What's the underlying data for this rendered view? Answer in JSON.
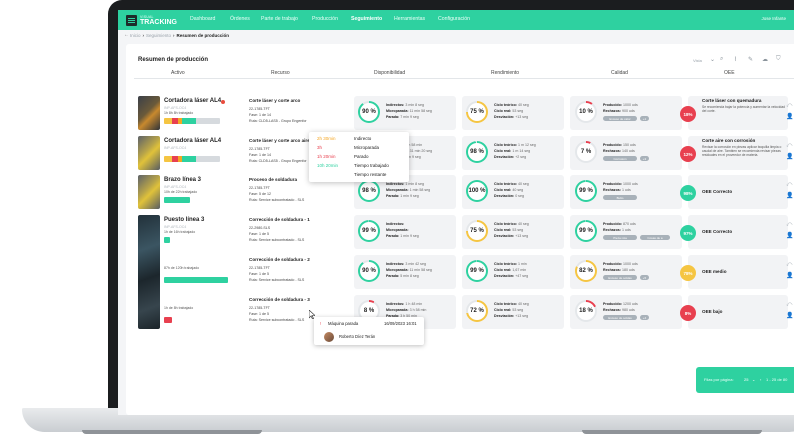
{
  "nav": {
    "logo_small": "VISUAL",
    "logo_big": "TRACKING",
    "items": [
      "Dashboard",
      "Órdenes",
      "Parte de trabajo",
      "Producción",
      "Seguimiento",
      "Herramientas",
      "Configuración"
    ],
    "active": "Seguimiento",
    "user": "Jose Infante"
  },
  "breadcrumb": {
    "items": [
      "Inicio",
      "Seguimiento"
    ],
    "current": "Resumen de producción"
  },
  "card": {
    "title": "Resumen de producción",
    "view_label": "Vista",
    "columns": [
      "Activo",
      "Recurso",
      "Disponibilidad",
      "Rendimiento",
      "Calidad",
      "OEE"
    ]
  },
  "rows": [
    {
      "asset": {
        "name": "Cortadora láser AL4",
        "code": "INP-AFS-OC4",
        "status": "1h 8h 8h trabajado"
      },
      "job": {
        "title": "Corte láser y corte arco",
        "ref": "22-1785-TFT",
        "phase": "Fase: 1 de 14",
        "route": "Ruta: CLD5-LAS5 - Grupo Engenfor"
      },
      "availability": {
        "pct": "90 %",
        "value": 90,
        "l1": "Indirectos:",
        "v1": "3 min 8 seg",
        "l2": "Microparada:",
        "v2": "11 min 58 seg",
        "l3": "Parada:",
        "v3": "7 min 9 seg"
      },
      "performance": {
        "pct": "75 %",
        "value": 75,
        "l1": "Ciclo teórico:",
        "v1": "40 seg",
        "l2": "Ciclo real:",
        "v2": "53 seg",
        "l3": "Desviación:",
        "v3": "+13 seg"
      },
      "quality": {
        "pct": "10 %",
        "value": 10,
        "l1": "Producido:",
        "v1": "1000 uds",
        "l2": "Rechazos:",
        "v2": "900 uds",
        "pill1": "Exceso de calor",
        "pill2": "+1"
      },
      "oee": {
        "value": "18%",
        "color": "#e8404f",
        "title": "Corte láser con quemadura",
        "desc": "Se recomienda bajar la potencia y aumentar la velocidad del corte."
      }
    },
    {
      "asset": {
        "name": "Cortadora láser AL4",
        "code": "INP-AFS-OC4",
        "status": ""
      },
      "job": {
        "title": "Corte láser y corte arco aire",
        "ref": "22-1785-TFT",
        "phase": "Fase: 1 de 14",
        "route": "Ruta: CLD5-LAS5 - Grupo Engenfor"
      },
      "availability": {
        "pct": "42 %",
        "value": 42,
        "l1": "Indirectos:",
        "v1": "1 h 58 min",
        "l2": "Microparada:",
        "v2": "31 min 20 seg",
        "l3": "Parada:",
        "v3": "50 min 9 seg"
      },
      "performance": {
        "pct": "98 %",
        "value": 98,
        "l1": "Ciclo teórico:",
        "v1": "1 m 12 seg",
        "l2": "Ciclo real:",
        "v2": "1 m 14 seg",
        "l3": "Desviación:",
        "v3": "+2 seg"
      },
      "quality": {
        "pct": "7 %",
        "value": 7,
        "l1": "Producido:",
        "v1": "150 uds",
        "l2": "Rechazos:",
        "v2": "140 uds",
        "pill1": "Corrosión",
        "pill2": "+3"
      },
      "oee": {
        "value": "12%",
        "color": "#e8404f",
        "title": "Corte aire con corrosión",
        "desc": "Revisar la corrosión en piezas aplicar boquilla limpia o caudal de aire. Tambien se recomienda revisar piezas residuales en el proveedor de materia."
      }
    },
    {
      "asset": {
        "name": "Brazo línea 3",
        "code": "INP-AFS-OC4",
        "status": "10h de 22h trabajado"
      },
      "job": {
        "title": "Proceso de soldadura",
        "ref": "22-1785-TFT",
        "phase": "Fase: 5 de 12",
        "route": "Ruta: Service subcontratado - SLS"
      },
      "availability": {
        "pct": "98 %",
        "value": 98,
        "l1": "Indirectos:",
        "v1": "1 min 8 seg",
        "l2": "Microparada:",
        "v2": "1 min 58 seg",
        "l3": "Parada:",
        "v3": "1 min 9 seg"
      },
      "performance": {
        "pct": "100 %",
        "value": 100,
        "l1": "Ciclo teórico:",
        "v1": "40 seg",
        "l2": "Ciclo real:",
        "v2": "40 seg",
        "l3": "Desviación:",
        "v3": "0 seg"
      },
      "quality": {
        "pct": "99 %",
        "value": 99,
        "l1": "Producido:",
        "v1": "1000 uds",
        "l2": "Rechazos:",
        "v2": "1 uds",
        "pill1": "Bulto",
        "pill2": ""
      },
      "oee": {
        "value": "98%",
        "color": "#2ed1a0",
        "title": "OEE Correcto",
        "desc": ""
      }
    },
    {
      "asset": {
        "name": "Puesto línea 3",
        "code": "INP-AFS-OC4",
        "status": "1h de 16h trabajado"
      },
      "job": {
        "title": "Corrección de soldadura - 1",
        "ref": "22-2980-SLS",
        "phase": "Fase: 1 de 5",
        "route": "Ruta: Service subcontratado - SLS"
      },
      "availability": {
        "pct": "99 %",
        "value": 99,
        "l1": "Indirectos:",
        "v1": "",
        "l2": "Microparada:",
        "v2": "",
        "l3": "Parada:",
        "v3": "1 min 9 seg"
      },
      "performance": {
        "pct": "75 %",
        "value": 75,
        "l1": "Ciclo teórico:",
        "v1": "40 seg",
        "l2": "Ciclo real:",
        "v2": "53 seg",
        "l3": "Desviación:",
        "v3": "+13 seg"
      },
      "quality": {
        "pct": "99 %",
        "value": 99,
        "l1": "Producido:",
        "v1": "870 uds",
        "l2": "Rechazos:",
        "v2": "1 uds",
        "pill1": "Pieza rota",
        "pill2": "Cosas de a"
      },
      "oee": {
        "value": "97%",
        "color": "#2ed1a0",
        "title": "OEE Correcto",
        "desc": ""
      }
    },
    {
      "asset": {
        "name": "",
        "code": "",
        "status": "87h de 120h trabajado"
      },
      "job": {
        "title": "Corrección de soldadura - 2",
        "ref": "22-1785-TFT",
        "phase": "Fase: 1 de 5",
        "route": "Ruta: Service subcontratado - SLS"
      },
      "availability": {
        "pct": "90 %",
        "value": 90,
        "l1": "Indirectos:",
        "v1": "3 min 42 seg",
        "l2": "Microparada:",
        "v2": "11 min 58 seg",
        "l3": "Parada:",
        "v3": "5 min 8 seg"
      },
      "performance": {
        "pct": "99 %",
        "value": 99,
        "l1": "Ciclo teórico:",
        "v1": "1 min",
        "l2": "Ciclo real:",
        "v2": "1,67 min",
        "l3": "Desviación:",
        "v3": "+47 seg"
      },
      "quality": {
        "pct": "82 %",
        "value": 82,
        "l1": "Producido:",
        "v1": "1000 uds",
        "l2": "Rechazos:",
        "v2": "180 uds",
        "pill1": "Exceso de soldas",
        "pill2": "+5"
      },
      "oee": {
        "value": "78%",
        "color": "#f5c542",
        "title": "OEE medio",
        "desc": ""
      }
    },
    {
      "asset": {
        "name": "",
        "code": "",
        "status": "1h de 8h trabajado"
      },
      "job": {
        "title": "Corrección de soldadura - 3",
        "ref": "22-1785-TFT",
        "phase": "Fase: 1 de 5",
        "route": "Ruta: Service subcontratado - SLS"
      },
      "availability": {
        "pct": "8 %",
        "value": 8,
        "l1": "Indirectos:",
        "v1": "1 h 48 min",
        "l2": "Microparada:",
        "v2": "3 h 58 min",
        "l3": "Parada:",
        "v3": "3 h 50 min"
      },
      "performance": {
        "pct": "72 %",
        "value": 72,
        "l1": "Ciclo teórico:",
        "v1": "40 seg",
        "l2": "Ciclo real:",
        "v2": "53 seg",
        "l3": "Desviación:",
        "v3": "+13 seg"
      },
      "quality": {
        "pct": "18 %",
        "value": 18,
        "l1": "Producido:",
        "v1": "1200 uds",
        "l2": "Rechazos:",
        "v2": "980 uds",
        "pill1": "Exceso de soldas",
        "pill2": "+4"
      },
      "oee": {
        "value": "8%",
        "color": "#e8404f",
        "title": "OEE bajo",
        "desc": ""
      }
    }
  ],
  "popup": {
    "items": [
      {
        "time": "2h 30min",
        "label": "Indirecto",
        "color": "#f5a623"
      },
      {
        "time": "3h",
        "label": "Microparada",
        "color": "#e8404f"
      },
      {
        "time": "1h 20min",
        "label": "Parado",
        "color": "#e8404f"
      },
      {
        "time": "10h 20min",
        "label": "Tiempo trabajado",
        "color": "#2ed1a0"
      },
      {
        "time": "",
        "label": "Tiempo restante",
        "color": "#222222"
      }
    ]
  },
  "tooltip": {
    "event": "Máquina parada",
    "datetime": "16/09/2023 16:01",
    "person": "Roberto Díez Terán"
  },
  "pager": {
    "label": "Filas por página:",
    "per_page": "25",
    "range": "1 - 25 de 80"
  }
}
